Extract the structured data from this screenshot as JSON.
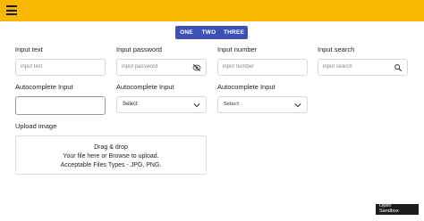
{
  "header": {
    "color": "#f9b701",
    "menu_icon": "hamburger-menu-icon"
  },
  "tabs": [
    {
      "label": "ONE"
    },
    {
      "label": "TWO"
    },
    {
      "label": "THREE"
    }
  ],
  "tabs_color": "#3f51b5",
  "fields": {
    "text": {
      "label": "Input text",
      "placeholder": "input text"
    },
    "password": {
      "label": "Input password",
      "placeholder": "input password",
      "icon": "eye-off-icon"
    },
    "number": {
      "label": "Input number",
      "placeholder": "input number"
    },
    "search": {
      "label": "Input search",
      "placeholder": "input search",
      "icon": "search-icon"
    }
  },
  "autocomplete": [
    {
      "label": "Autocomplete Input",
      "value": ""
    },
    {
      "label": "Autocomplete Input",
      "value": "Select"
    },
    {
      "label": "Autocomplete Input",
      "value": "Select"
    }
  ],
  "upload": {
    "label": "Upload image",
    "lines": [
      "Drag & drop",
      "Your file here or Browse to upload.",
      "Acceptable Files Types - JPG, PNG."
    ]
  },
  "sandbox_button": {
    "line1": "Open",
    "line2": "Sandbox"
  }
}
